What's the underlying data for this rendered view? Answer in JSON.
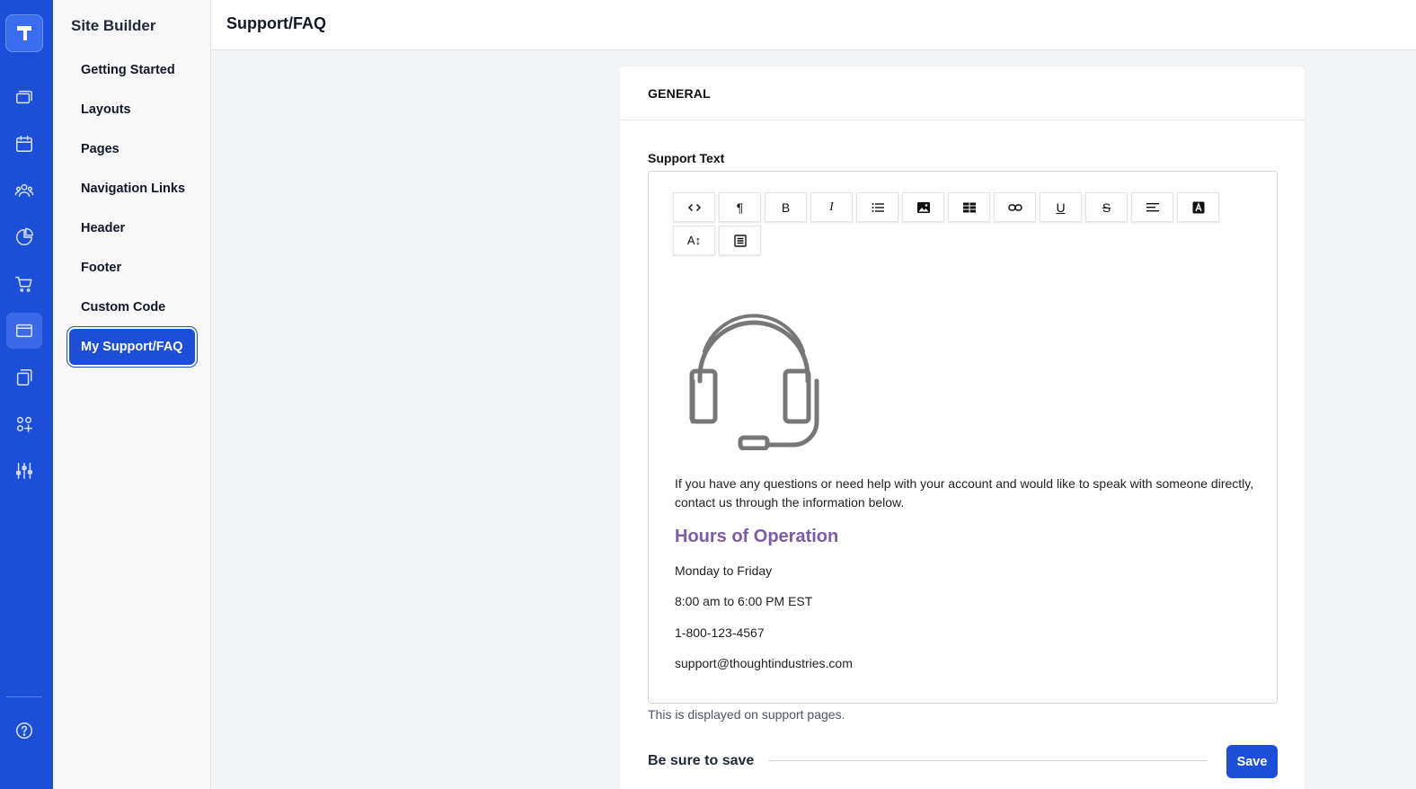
{
  "rail": {
    "items": [
      {
        "name": "logo-icon"
      },
      {
        "name": "courses-icon"
      },
      {
        "name": "calendar-icon"
      },
      {
        "name": "users-icon"
      },
      {
        "name": "reports-icon"
      },
      {
        "name": "cart-icon"
      },
      {
        "name": "site-builder-icon",
        "active": true
      },
      {
        "name": "content-icon"
      },
      {
        "name": "apps-icon"
      },
      {
        "name": "settings-sliders-icon"
      },
      {
        "name": "help-icon"
      }
    ]
  },
  "sidebar": {
    "title": "Site Builder",
    "items": [
      {
        "label": "Getting Started"
      },
      {
        "label": "Layouts"
      },
      {
        "label": "Pages"
      },
      {
        "label": "Navigation Links"
      },
      {
        "label": "Header"
      },
      {
        "label": "Footer"
      },
      {
        "label": "Custom Code"
      },
      {
        "label": "My Support/FAQ",
        "active": true
      }
    ]
  },
  "header": {
    "title": "Support/FAQ"
  },
  "card": {
    "section_title": "GENERAL",
    "field_label": "Support Text",
    "toolbar": [
      {
        "name": "code-view-icon",
        "glyph": "<>"
      },
      {
        "name": "paragraph-icon",
        "glyph": "¶"
      },
      {
        "name": "bold-icon",
        "glyph": "B"
      },
      {
        "name": "italic-icon",
        "glyph": "I"
      },
      {
        "name": "bullet-list-icon"
      },
      {
        "name": "image-icon"
      },
      {
        "name": "table-icon"
      },
      {
        "name": "link-icon"
      },
      {
        "name": "underline-icon",
        "glyph": "U"
      },
      {
        "name": "strikethrough-icon",
        "glyph": "S"
      },
      {
        "name": "align-icon"
      },
      {
        "name": "font-color-icon",
        "glyph": "A"
      },
      {
        "name": "font-size-icon",
        "glyph": "A↕"
      },
      {
        "name": "source-icon"
      }
    ],
    "editor": {
      "intro": "If you have any questions or need help with your account and would like to speak with someone directly, contact us through the information below.",
      "heading": "Hours of Operation",
      "heading_color": "#7b5ba6",
      "days": "Monday to Friday",
      "hours": "8:00 am to 6:00 PM EST",
      "phone": "1-800-123-4567",
      "email": "support@thoughtindustries.com"
    },
    "helper_text": "This is displayed on support pages.",
    "save_hint": "Be sure to save",
    "save_label": "Save"
  },
  "colors": {
    "primary": "#1d4ed8",
    "accent_heading": "#7b5ba6"
  }
}
